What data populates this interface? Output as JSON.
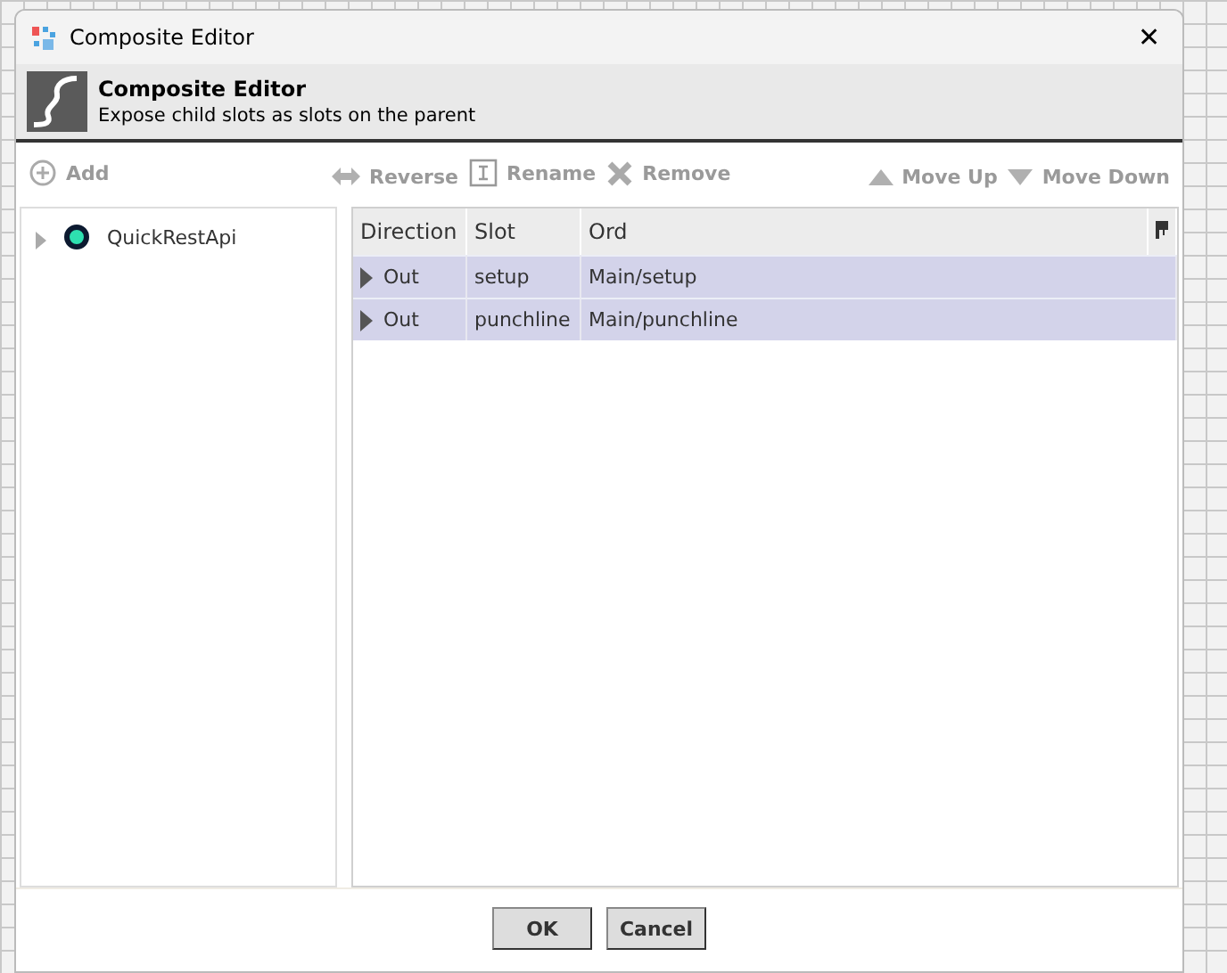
{
  "window": {
    "title": "Composite Editor",
    "close": "✕"
  },
  "header": {
    "title": "Composite Editor",
    "subtitle": "Expose child slots as slots on the parent"
  },
  "left_toolbar": [
    {
      "kind": "add",
      "label": "Add",
      "disabled": true
    }
  ],
  "toolbar": [
    {
      "kind": "reverse",
      "label": "Reverse",
      "disabled": true
    },
    {
      "kind": "rename",
      "label": "Rename",
      "disabled": true
    },
    {
      "kind": "remove",
      "label": "Remove",
      "disabled": true
    },
    {
      "kind": "up",
      "label": "Move Up",
      "disabled": true
    },
    {
      "kind": "down",
      "label": "Move Down",
      "disabled": true
    }
  ],
  "tree": [
    {
      "label": "QuickRestApi",
      "expanded": false,
      "color": "#2ee0b0"
    }
  ],
  "table": {
    "columns": [
      "Direction",
      "Slot",
      "Ord"
    ],
    "rows": [
      {
        "direction": "Out",
        "slot": "setup",
        "ord": "Main/setup",
        "selected": true
      },
      {
        "direction": "Out",
        "slot": "punchline",
        "ord": "Main/punchline",
        "selected": true
      }
    ]
  },
  "buttons": [
    "OK",
    "Cancel"
  ]
}
